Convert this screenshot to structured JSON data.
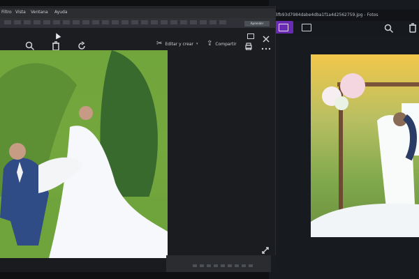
{
  "back_window": {
    "title": "3fb93d7984dabe4dba1f1a4d2562759.jpg - Fotos",
    "toolbar_icons": [
      "favorite-icon",
      "image-icon",
      "zoom-icon",
      "delete-icon"
    ]
  },
  "front_window": {
    "menu": [
      "Filtro",
      "Vista",
      "Ventana",
      "Ayuda"
    ],
    "toolbar_button": "Aprender",
    "photo_toolbar": {
      "zoom_icon": "zoom-icon",
      "delete_icon": "delete-icon",
      "rotate_icon": "rotate-icon",
      "edit_label": "Editar y crear",
      "share_label": "Compartir",
      "print_icon": "print-icon",
      "more_icon": "more-icon"
    }
  }
}
